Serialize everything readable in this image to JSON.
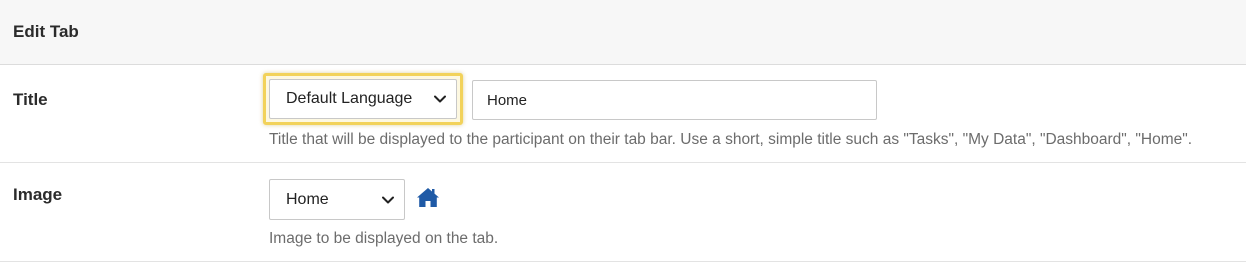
{
  "header": {
    "title": "Edit Tab"
  },
  "title_row": {
    "label": "Title",
    "language_select": {
      "selected": "Default Language"
    },
    "title_input": {
      "value": "Home"
    },
    "help": "Title that will be displayed to the participant on their tab bar. Use a short, simple title such as \"Tasks\", \"My Data\", \"Dashboard\", \"Home\"."
  },
  "image_row": {
    "label": "Image",
    "image_select": {
      "selected": "Home"
    },
    "preview_icon": "home-icon",
    "help": "Image to be displayed on the tab."
  },
  "colors": {
    "focus_highlight": "#f2d25a",
    "icon_blue": "#1f5aa6"
  }
}
